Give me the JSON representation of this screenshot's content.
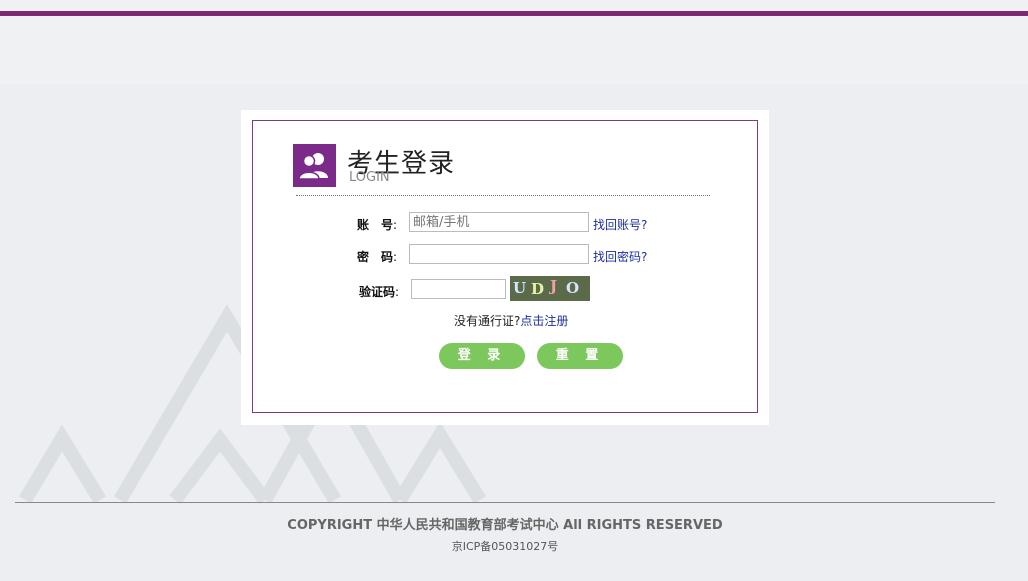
{
  "header": {
    "stripe_color": "#7b2a73"
  },
  "login": {
    "title": "考生登录",
    "subtitle": "LOGIN",
    "account_label": "账　号",
    "account_placeholder": "邮箱/手机",
    "find_account_link": "找回账号?",
    "password_label": "密　码",
    "find_password_link": "找回密码?",
    "captcha_label": "验证码",
    "captcha_chars": [
      "U",
      "D",
      "J",
      "O"
    ],
    "captcha_colors": [
      "#cfe6ff",
      "#e7f1a8",
      "#f2a0a6",
      "#d7e3ff"
    ],
    "register_text": "没有通行证?",
    "register_link": "点击注册",
    "login_button": "登 录",
    "reset_button": "重 置",
    "accent_color": "#7b2a8a",
    "button_color": "#7cc85d"
  },
  "footer": {
    "copyright": "COPYRIGHT 中华人民共和国教育部考试中心 All RIGHTS RESERVED",
    "icp": "京ICP备05031027号"
  }
}
